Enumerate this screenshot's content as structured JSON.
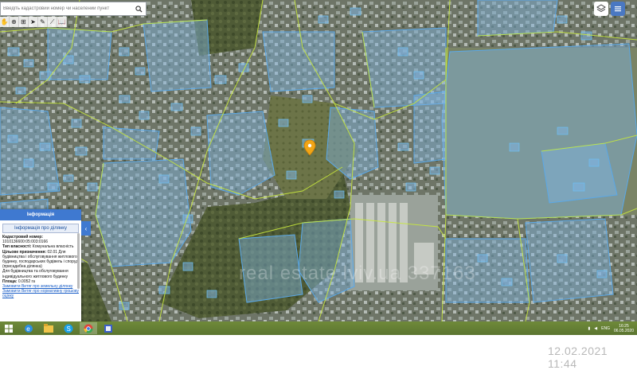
{
  "search": {
    "placeholder": "Введіть кадастровий номер чи населений пункт"
  },
  "toolbar": {
    "tools": [
      "hand-icon",
      "zoom-icon",
      "measure-icon",
      "pointer-icon",
      "edit-icon",
      "ruler-icon",
      "book-icon"
    ]
  },
  "top_right": {
    "layers_icon": "layers-icon",
    "menu_icon": "menu-icon"
  },
  "info_panel": {
    "title": "Інформація",
    "subtitle": "Інформація про ділянку",
    "cadastral_label": "Кадастровий номер:",
    "cadastral_value": "1010136600:05:003:0166",
    "ownership_label": "Тип власності:",
    "ownership_value": "Комунальна власність",
    "purpose_label": "Цільове призначення:",
    "purpose_value": "02.01 Для будівництва і обслуговування житлового будинку, господарських будівель і споруд (присадибна ділянка)",
    "purpose_value2": "Для будівництва та обслуговування індивідуального житлового будинку",
    "area_label": "Площа:",
    "area_value": "0.0052 га",
    "link1": "Замовити Витяг про земельну ділянку",
    "link2": "Замовити Витяг про нормативну грошову оцінку"
  },
  "watermark": "real estate lviv.ua 337163",
  "taskbar": {
    "lang": "ENG",
    "time": "16:25",
    "date": "06.05.2020"
  },
  "stamp": "12.02.2021 11:44",
  "colors": {
    "parcel_fill": "#7fb3e0",
    "parcel_stroke": "#5aa8e8",
    "boundary_line": "#c8e83c",
    "marker": "#f2a516",
    "panel_header": "#3f79d0",
    "taskbar": "#6f8a3a"
  }
}
